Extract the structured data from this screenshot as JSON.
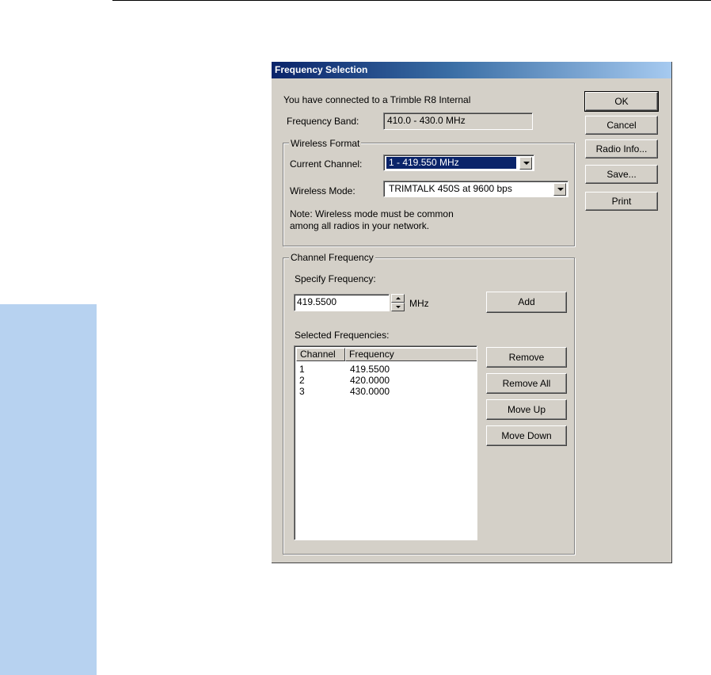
{
  "dialog": {
    "title": "Frequency Selection",
    "connected_text": "You have connected to a Trimble R8 Internal",
    "frequency_band_label": "Frequency Band:",
    "frequency_band_value": "410.0 - 430.0 MHz",
    "wireless_format": {
      "group_label": "Wireless Format",
      "current_channel_label": "Current Channel:",
      "current_channel_value": "1 - 419.550 MHz",
      "wireless_mode_label": "Wireless Mode:",
      "wireless_mode_value": "TRIMTALK 450S at 9600 bps",
      "note_line1": "Note: Wireless mode must be common",
      "note_line2": "among all radios in your network."
    },
    "channel_frequency": {
      "group_label": "Channel Frequency",
      "specify_label": "Specify Frequency:",
      "frequency_value": "419.5500",
      "unit": "MHz",
      "add_label": "Add",
      "selected_label": "Selected Frequencies:",
      "columns": [
        "Channel",
        "Frequency"
      ],
      "rows": [
        {
          "channel": "1",
          "frequency": "419.5500"
        },
        {
          "channel": "2",
          "frequency": "420.0000"
        },
        {
          "channel": "3",
          "frequency": "430.0000"
        }
      ],
      "remove_label": "Remove",
      "remove_all_label": "Remove All",
      "move_up_label": "Move Up",
      "move_down_label": "Move Down"
    },
    "buttons": {
      "ok": "OK",
      "cancel": "Cancel",
      "radio_info": "Radio Info...",
      "save": "Save...",
      "print": "Print"
    }
  },
  "colors": {
    "titlebar_start": "#0a246a",
    "titlebar_end": "#a6caf0",
    "dialog_face": "#d4d0c8",
    "sidebar": "#b7d2f0"
  }
}
